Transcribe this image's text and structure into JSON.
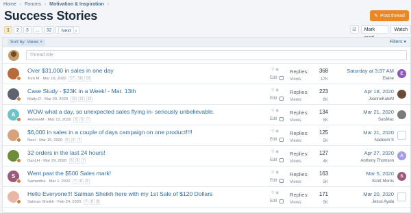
{
  "breadcrumb": {
    "home": "Home",
    "forums": "Forums",
    "section": "Motivation & Inspiration"
  },
  "page_title": "Success Stories",
  "post_thread_label": "Post thread",
  "pager": {
    "pages": [
      "1",
      "2",
      "3",
      "...",
      "32"
    ],
    "next": "Next"
  },
  "actions": {
    "mark_read": "Mark read",
    "watch": "Watch"
  },
  "filter": {
    "sort": "Sort by: Views",
    "filters": "Filters"
  },
  "new_thread_placeholder": "Thread title",
  "labels": {
    "replies": "Replies:",
    "views": "Views:",
    "edit": "Edit"
  },
  "colors": {
    "accent": "#e98826",
    "link": "#2e6ca8"
  },
  "threads": [
    {
      "title": "Over $31,000 in sales in one day",
      "author": "Tom M",
      "date": "Mar 19, 2020",
      "pages": [
        "17",
        "18",
        "19"
      ],
      "replies": "368",
      "views": "17K",
      "last_date": "Saturday at 3:37 AM",
      "last_user": "Elaine",
      "avatar_letter": "",
      "avatar_color": "#b86a3b",
      "last_avatar_letter": "E",
      "last_avatar_color": "#8e5ab8"
    },
    {
      "title": "Case Study - $23K in a Week! - Mar. 13th",
      "author": "Matty.O",
      "date": "Mar 29, 2020",
      "pages": [
        "10",
        "11",
        "12"
      ],
      "replies": "223",
      "views": "8K",
      "last_date": "Apr 18, 2020",
      "last_user": "JeanneKateM",
      "avatar_letter": "",
      "avatar_color": "#5c6470",
      "last_avatar_letter": "",
      "last_avatar_color": "#6b4a3a"
    },
    {
      "title": "WOW what a day, so unexpected sales flying in- seriously unbelievable.",
      "author": "AndrewM",
      "date": "Mar 12, 2020",
      "pages": [
        "5",
        "6",
        "7"
      ],
      "replies": "134",
      "views": "5K",
      "last_date": "Mar 21, 2020",
      "last_user": "SuisMac",
      "avatar_letter": "A",
      "avatar_color": "#6cc4c9",
      "last_avatar_letter": "",
      "last_avatar_color": "#7a7a7a"
    },
    {
      "title": "$6,000 in sales in a couple of days campaign on one product!!!!",
      "author": "Noel",
      "date": "Mar 15, 2020",
      "pages": [
        "5",
        "6",
        "7"
      ],
      "replies": "125",
      "views": "5K",
      "last_date": "Mar 21, 2020",
      "last_user": "Nadeem S",
      "avatar_letter": "",
      "avatar_color": "#d8a37c",
      "last_avatar_letter": "",
      "last_avatar_color": ""
    },
    {
      "title": "32 orders in the last 24 hours!",
      "author": "DanLH",
      "date": "Mar 29, 2020",
      "pages": [
        "5",
        "6",
        "7"
      ],
      "replies": "127",
      "views": "4K",
      "last_date": "Apr 27, 2020",
      "last_user": "Anthony Thomson",
      "avatar_letter": "",
      "avatar_color": "#6e8c3a",
      "last_avatar_letter": "A",
      "last_avatar_color": "#a99be0"
    },
    {
      "title": "Went past the $500 Sales mark!",
      "author": "Samantha",
      "date": "Mar 1, 2020",
      "pages": [
        "7",
        "8",
        "9"
      ],
      "replies": "163",
      "views": "5K",
      "last_date": "Mar 5, 2020",
      "last_user": "Scott Morris",
      "avatar_letter": "S",
      "avatar_color": "#9c5a7a",
      "last_avatar_letter": "S",
      "last_avatar_color": "#9c5a7a"
    },
    {
      "title": "Hello Everyone!!! Salman Sheikh here with my 1st Sale of $120 Dollars",
      "author": "Salman Sheikh",
      "date": "Feb 24, 2020",
      "pages": [
        "7",
        "8",
        "9"
      ],
      "replies": "171",
      "views": "5K",
      "last_date": "Mar 20, 2020",
      "last_user": "Jesus Ayala",
      "avatar_letter": "",
      "avatar_color": "#e9b7a5",
      "last_avatar_letter": "",
      "last_avatar_color": ""
    }
  ]
}
